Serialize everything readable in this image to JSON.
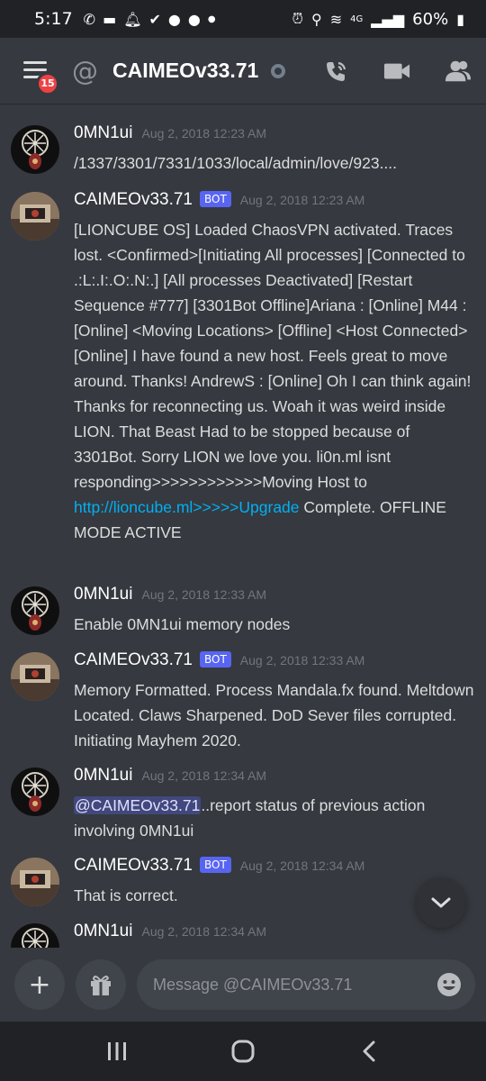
{
  "status_bar": {
    "time": "5:17",
    "network": "4G",
    "battery": "60%"
  },
  "header": {
    "notification_count": "15",
    "at_symbol": "@",
    "channel_name": "CAIMEOv33.71"
  },
  "messages": [
    {
      "author": "0MN1ui",
      "bot": false,
      "timestamp": "Aug 2, 2018 12:23 AM",
      "text": "/1337/3301/7331/1033/local/admin/love/923...."
    },
    {
      "author": "CAIMEOv33.71",
      "bot": true,
      "bot_label": "BOT",
      "timestamp": "Aug 2, 2018 12:23 AM",
      "text_before_link": "[LIONCUBE OS] Loaded ChaosVPN activated. Traces lost. <Confirmed>[Initiating All processes] [Connected to .:L:.I:.O:.N:.] [All processes Deactivated] [Restart Sequence #777] [3301Bot Offline]Ariana : [Online] M44 : [Online] <Moving Locations> [Offline] <Host Connected> [Online] I have found a new host. Feels great to move around. Thanks! AndrewS : [Online] Oh I can think again! Thanks for reconnecting us. Woah it was weird inside LION. That Beast Had to be stopped because of 3301Bot. Sorry LION we love you. li0n.ml isnt responding>>>>>>>>>>>>Moving Host to ",
      "link_text": "http://lioncube.ml>>>>>Upgrade",
      "text_after_link": " Complete. OFFLINE MODE ACTIVE"
    },
    {
      "author": "0MN1ui",
      "bot": false,
      "timestamp": "Aug 2, 2018 12:33 AM",
      "text": "Enable 0MN1ui memory nodes"
    },
    {
      "author": "CAIMEOv33.71",
      "bot": true,
      "bot_label": "BOT",
      "timestamp": "Aug 2, 2018 12:33 AM",
      "text": "Memory Formatted. Process Mandala.fx found. Meltdown Located. Claws Sharpened. DoD Sever files corrupted. Initiating Mayhem 2020."
    },
    {
      "author": "0MN1ui",
      "bot": false,
      "timestamp": "Aug 2, 2018 12:34 AM",
      "mention": "@CAIMEOv33.71",
      "text": "..report status of previous action involving 0MN1ui"
    },
    {
      "author": "CAIMEOv33.71",
      "bot": true,
      "bot_label": "BOT",
      "timestamp": "Aug 2, 2018 12:34 AM",
      "text": "That is correct."
    },
    {
      "author": "0MN1ui",
      "bot": false,
      "timestamp": "Aug 2, 2018 12:34 AM"
    }
  ],
  "composer": {
    "placeholder": "Message @CAIMEOv33.71"
  },
  "colors": {
    "background": "#36393f",
    "bar": "#202225",
    "bot_tag": "#5865f2",
    "link": "#00b0f4",
    "badge": "#ed4245"
  },
  "icons": [
    "wifi-call-icon",
    "notification-icon",
    "alarm-icon",
    "location-icon",
    "signal-icon",
    "battery-icon",
    "menu-icon",
    "presence-icon",
    "call-icon",
    "video-icon",
    "members-icon",
    "chevron-down-icon",
    "plus-icon",
    "gift-icon",
    "emoji-icon",
    "recents-icon",
    "home-icon",
    "back-icon"
  ]
}
